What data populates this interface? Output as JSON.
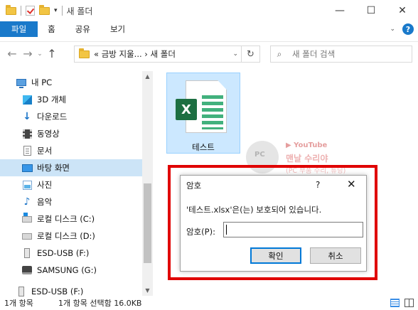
{
  "window": {
    "title": "새 폴더",
    "minimize": "—",
    "maximize": "☐",
    "close": "✕"
  },
  "ribbon": {
    "tabs": [
      "파일",
      "홈",
      "공유",
      "보기"
    ],
    "expand": "⌄",
    "help": "?"
  },
  "nav": {
    "back": "←",
    "forward": "→",
    "recent": "⌄",
    "up": "↑",
    "address": "« 금방 지울... › 새 폴더",
    "address_chevron": "⌄",
    "refresh": "↻",
    "search_placeholder": "새 폴더 검색",
    "search_icon": "⌕"
  },
  "sidebar": {
    "items": [
      {
        "label": "내 PC",
        "icon": "pc-icon"
      },
      {
        "label": "3D 개체",
        "icon": "3d-objects-icon"
      },
      {
        "label": "다운로드",
        "icon": "download-icon"
      },
      {
        "label": "동영상",
        "icon": "video-icon"
      },
      {
        "label": "문서",
        "icon": "document-icon"
      },
      {
        "label": "바탕 화면",
        "icon": "desktop-icon",
        "selected": true
      },
      {
        "label": "사진",
        "icon": "picture-icon"
      },
      {
        "label": "음악",
        "icon": "music-icon"
      },
      {
        "label": "로컬 디스크 (C:)",
        "icon": "windows-drive-icon"
      },
      {
        "label": "로컬 디스크 (D:)",
        "icon": "drive-icon"
      },
      {
        "label": "ESD-USB (F:)",
        "icon": "usb-drive-icon"
      },
      {
        "label": "SAMSUNG (G:)",
        "icon": "samsung-drive-icon"
      },
      {
        "label": "ESD-USB (F:)",
        "icon": "usb-drive-icon"
      }
    ]
  },
  "content": {
    "file": {
      "name": "테스트",
      "badge": "X"
    }
  },
  "watermark": {
    "badge": "PC",
    "youtube": "▶ YouTube",
    "line1": "맨날 수리야",
    "line2": "(PC 부품 수리, 튜닝)"
  },
  "dialog": {
    "title": "암호",
    "help": "?",
    "close": "✕",
    "message": "'테스트.xlsx'은(는) 보호되어 있습니다.",
    "password_label": "암호(P):",
    "password_value": "",
    "ok_label": "확인",
    "cancel_label": "취소"
  },
  "status": {
    "count": "1개 항목",
    "selected": "1개 항목 선택함 16.0KB"
  },
  "colors": {
    "accent": "#1979ca",
    "highlight": "#e00000",
    "excel_green": "#1d6f42"
  }
}
